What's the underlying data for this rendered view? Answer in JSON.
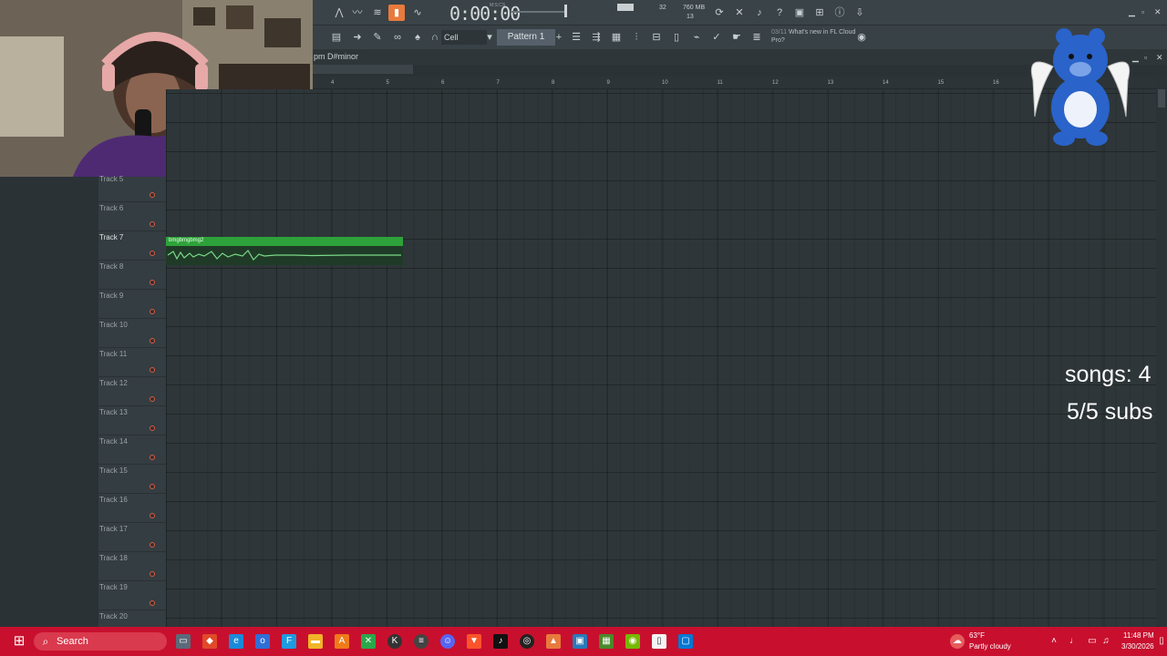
{
  "transport": {
    "time": "0:00:00",
    "time_unit_label": "M:S:CS",
    "cpu": "32",
    "memory": "760 MB",
    "polyphony": "13"
  },
  "toolbar": {
    "snap": "Cell",
    "pattern": "Pattern 1",
    "news_date": "03/11",
    "news_text": "What's new in FL Cloud Pro?"
  },
  "playlist": {
    "title": "pm D#minor",
    "timeline": [
      "4",
      "5",
      "6",
      "7",
      "8",
      "9",
      "10",
      "11",
      "12",
      "13",
      "14",
      "15",
      "16"
    ],
    "tracks": [
      {
        "label": "Track 5",
        "active": false
      },
      {
        "label": "Track 6",
        "active": false
      },
      {
        "label": "Track 7",
        "active": true
      },
      {
        "label": "Track 8",
        "active": false
      },
      {
        "label": "Track 9",
        "active": false
      },
      {
        "label": "Track 10",
        "active": false
      },
      {
        "label": "Track 11",
        "active": false
      },
      {
        "label": "Track 12",
        "active": false
      },
      {
        "label": "Track 13",
        "active": false
      },
      {
        "label": "Track 14",
        "active": false
      },
      {
        "label": "Track 15",
        "active": false
      },
      {
        "label": "Track 16",
        "active": false
      },
      {
        "label": "Track 17",
        "active": false
      },
      {
        "label": "Track 18",
        "active": false
      },
      {
        "label": "Track 19",
        "active": false
      },
      {
        "label": "Track 20",
        "active": false
      }
    ],
    "clip": {
      "label": "bmgbmgbmg2",
      "color": "#2ea23a"
    }
  },
  "overlay": {
    "songs": "songs: 4",
    "subs": "5/5 subs"
  },
  "taskbar": {
    "search": "Search",
    "temperature": "63°F",
    "condition": "Partly cloudy",
    "time": "11:48 PM",
    "date": "3/30/2026",
    "accent": "#c8102e"
  }
}
